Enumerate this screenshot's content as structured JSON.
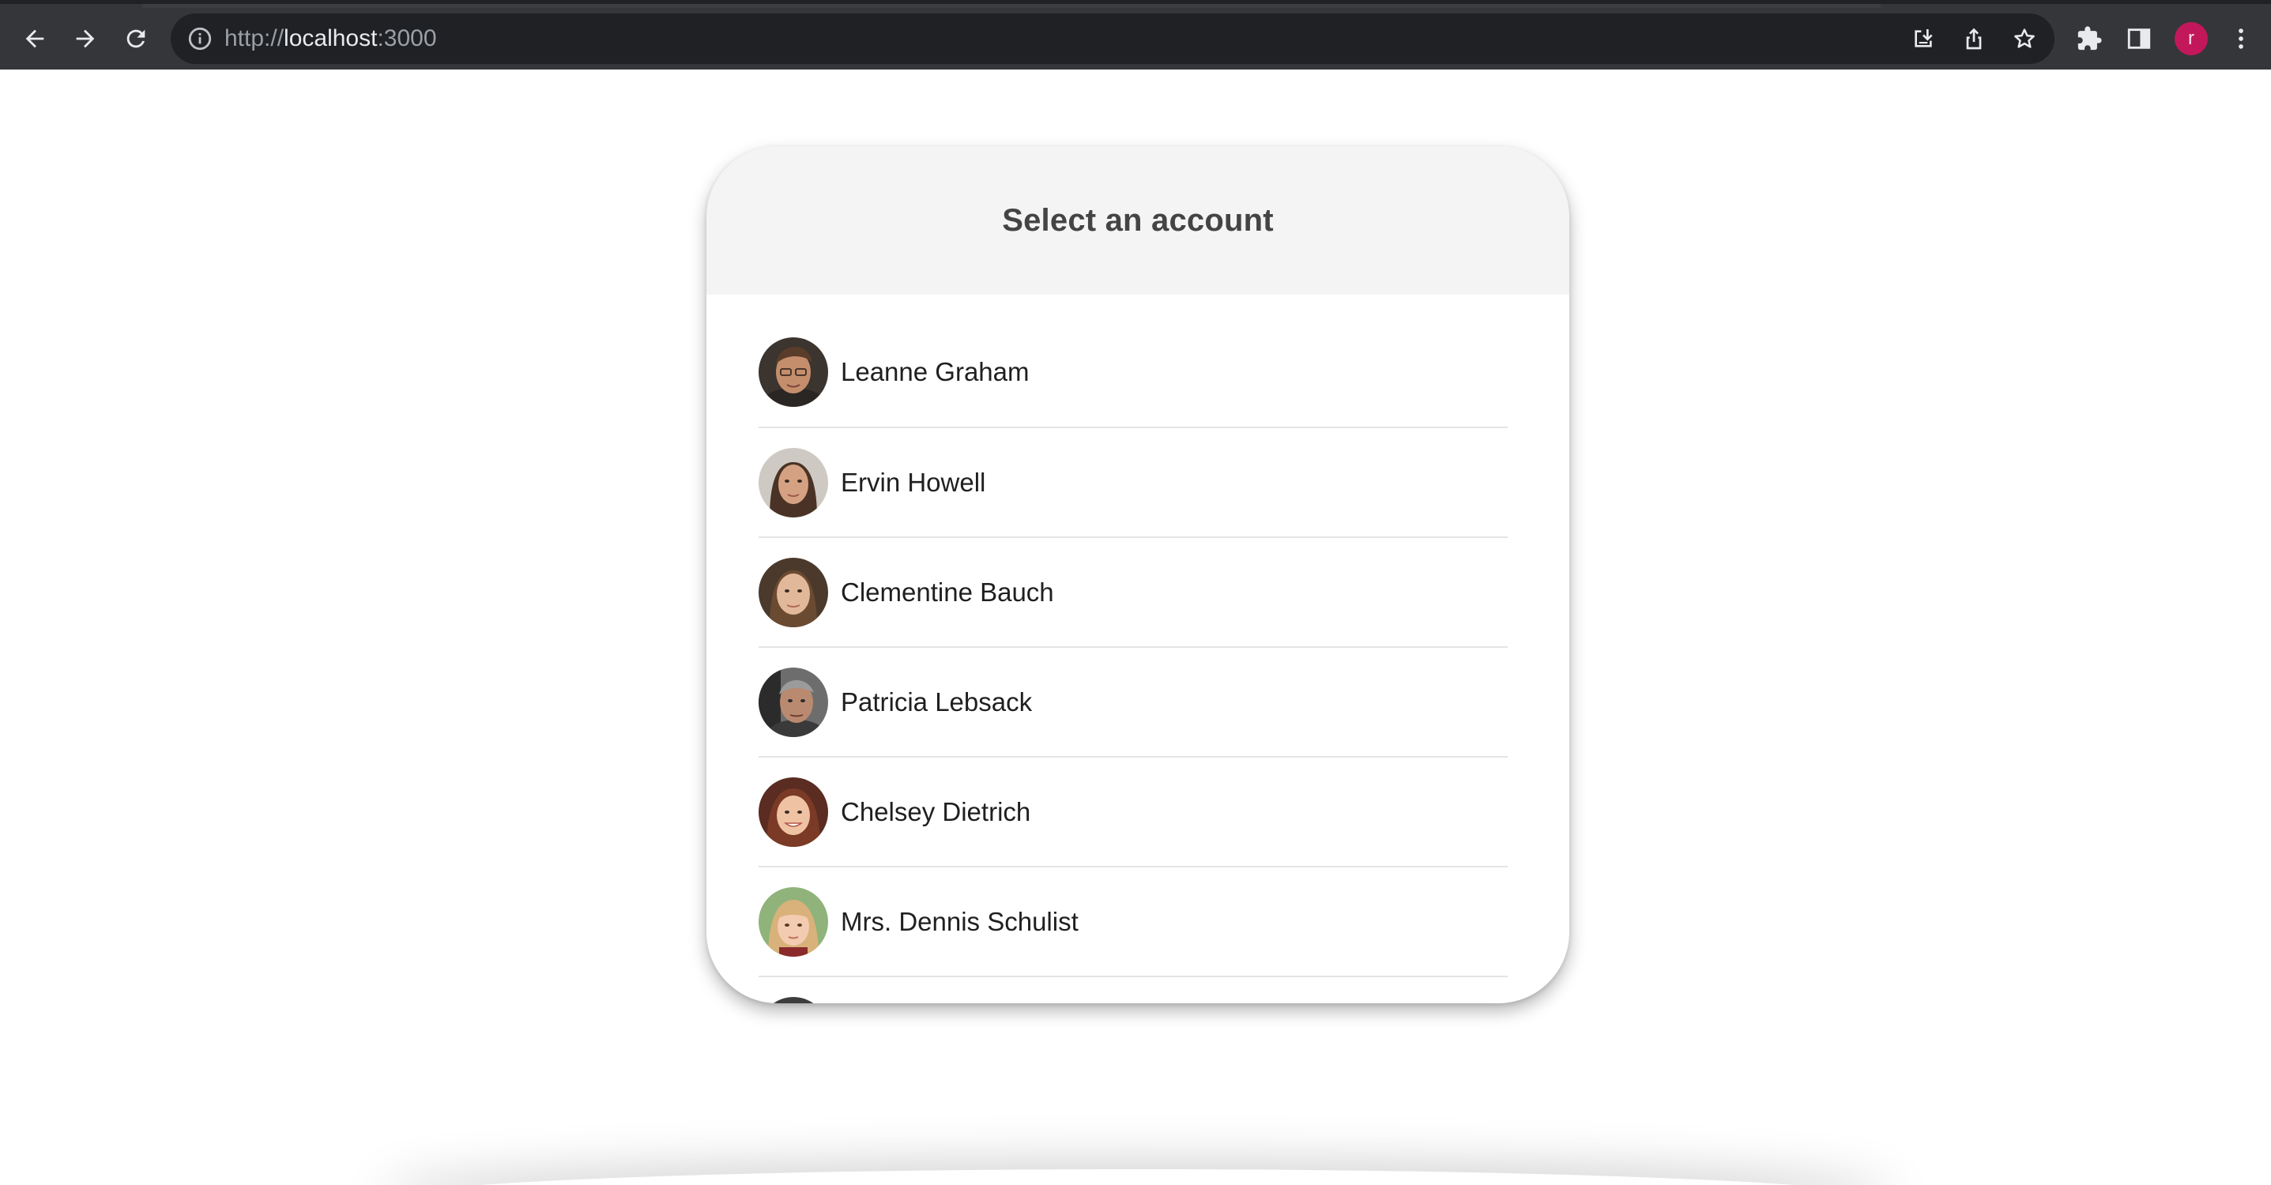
{
  "browser": {
    "url_scheme": "http://",
    "url_host": "localhost",
    "url_port": ":3000",
    "profile_initial": "r",
    "profile_color": "#c2185b",
    "icons": {
      "back": "back-arrow-icon",
      "forward": "forward-arrow-icon",
      "reload": "reload-icon",
      "site_info": "info-icon",
      "install": "install-app-icon",
      "share": "share-icon",
      "bookmark": "star-icon",
      "extensions": "puzzle-icon",
      "side_panel": "side-panel-icon",
      "menu": "kebab-menu-icon"
    }
  },
  "card": {
    "title": "Select an account",
    "accounts": [
      {
        "name": "Leanne Graham"
      },
      {
        "name": "Ervin Howell"
      },
      {
        "name": "Clementine Bauch"
      },
      {
        "name": "Patricia Lebsack"
      },
      {
        "name": "Chelsey Dietrich"
      },
      {
        "name": "Mrs. Dennis Schulist"
      }
    ]
  }
}
